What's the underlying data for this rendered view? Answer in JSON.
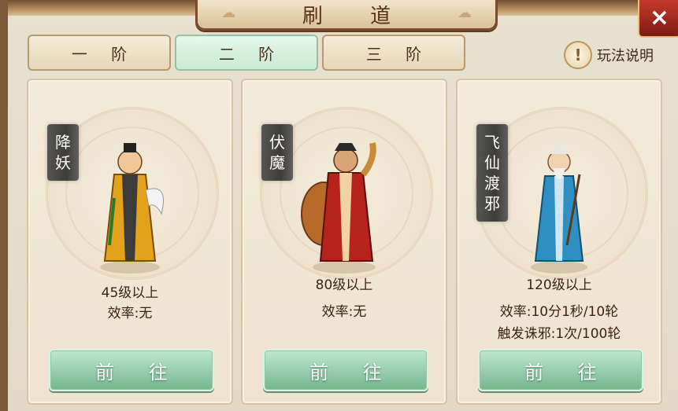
{
  "title": "刷 道",
  "tabs": [
    {
      "label": "一 阶",
      "active": false
    },
    {
      "label": "二 阶",
      "active": true
    },
    {
      "label": "三 阶",
      "active": false
    }
  ],
  "help": {
    "icon": "exclamation-icon",
    "label": "玩法说明"
  },
  "close": {
    "icon": "close-icon",
    "label": "×"
  },
  "cards": [
    {
      "name_chars": [
        "降",
        "妖"
      ],
      "level": "45级以上",
      "efficiency": "效率:无",
      "trigger": "",
      "button": "前 往",
      "robe_color": "#e2a21b"
    },
    {
      "name_chars": [
        "伏",
        "魔"
      ],
      "level": "80级以上",
      "efficiency": "效率:无",
      "trigger": "",
      "button": "前 往",
      "robe_color": "#b5231c"
    },
    {
      "name_chars": [
        "飞",
        "仙",
        "渡",
        "邪"
      ],
      "level": "120级以上",
      "efficiency": "效率:10分1秒/10轮",
      "trigger": "触发诛邪:1次/100轮",
      "button": "前 往",
      "robe_color": "#2f8fc2"
    }
  ]
}
